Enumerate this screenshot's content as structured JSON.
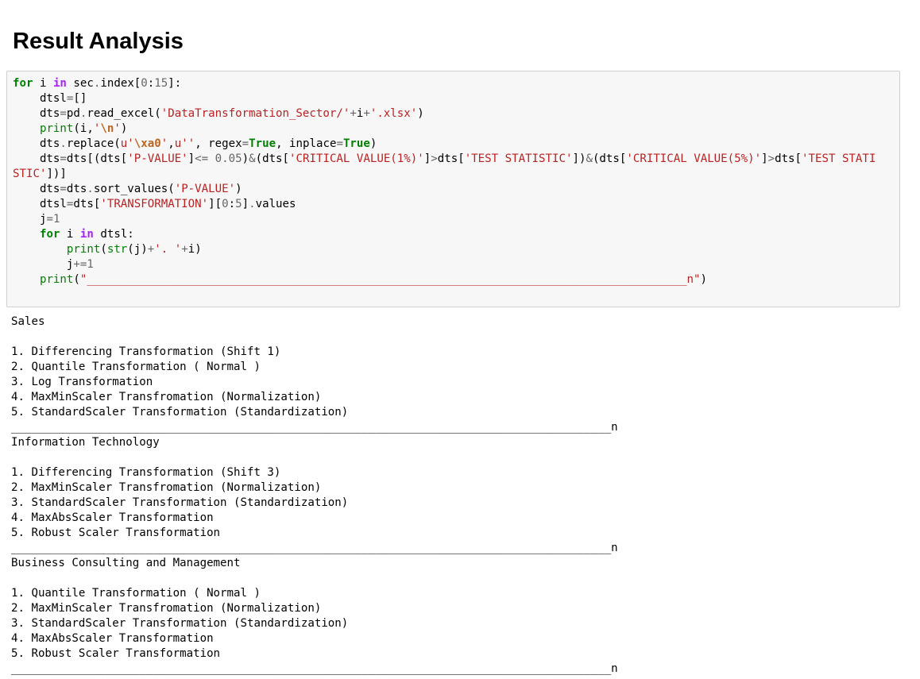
{
  "heading": "Result Analysis",
  "code": {
    "lines": [
      [
        [
          "kw",
          "for"
        ],
        [
          "",
          " i "
        ],
        [
          "kw2",
          "in"
        ],
        [
          "",
          " sec"
        ],
        [
          "op",
          "."
        ],
        [
          "",
          "index["
        ],
        [
          "num",
          "0"
        ],
        [
          "",
          ":"
        ],
        [
          "num",
          "15"
        ],
        [
          "",
          "]:"
        ]
      ],
      [
        [
          "",
          "    dtsl"
        ],
        [
          "op",
          "="
        ],
        [
          "",
          "[]"
        ]
      ],
      [
        [
          "",
          "    dts"
        ],
        [
          "op",
          "="
        ],
        [
          "",
          "pd"
        ],
        [
          "op",
          "."
        ],
        [
          "",
          "read_excel("
        ],
        [
          "str",
          "'DataTransformation_Sector/'"
        ],
        [
          "op",
          "+"
        ],
        [
          "",
          "i"
        ],
        [
          "op",
          "+"
        ],
        [
          "str",
          "'.xlsx'"
        ],
        [
          "",
          ")"
        ]
      ],
      [
        [
          "",
          "    "
        ],
        [
          "bi",
          "print"
        ],
        [
          "",
          "(i,"
        ],
        [
          "str",
          "'"
        ],
        [
          "esc",
          "\\n"
        ],
        [
          "str",
          "'"
        ],
        [
          "",
          ")"
        ]
      ],
      [
        [
          "",
          "    dts"
        ],
        [
          "op",
          "."
        ],
        [
          "",
          "replace("
        ],
        [
          "str",
          "u'"
        ],
        [
          "esc",
          "\\xa0"
        ],
        [
          "str",
          "'"
        ],
        [
          "",
          ","
        ],
        [
          "str",
          "u''"
        ],
        [
          "",
          ", regex"
        ],
        [
          "op",
          "="
        ],
        [
          "kw",
          "True"
        ],
        [
          "",
          ", inplace"
        ],
        [
          "op",
          "="
        ],
        [
          "kw",
          "True"
        ],
        [
          "",
          ")"
        ]
      ],
      [
        [
          "",
          "    dts"
        ],
        [
          "op",
          "="
        ],
        [
          "",
          "dts[(dts["
        ],
        [
          "str",
          "'P-VALUE'"
        ],
        [
          "",
          "]"
        ],
        [
          "op",
          "<="
        ],
        [
          "",
          " "
        ],
        [
          "num",
          "0.05"
        ],
        [
          "",
          ")"
        ],
        [
          "op",
          "&"
        ],
        [
          "",
          "(dts["
        ],
        [
          "str",
          "'CRITICAL VALUE(1%)'"
        ],
        [
          "",
          "]"
        ],
        [
          "op",
          ">"
        ],
        [
          "",
          "dts["
        ],
        [
          "str",
          "'TEST STATISTIC'"
        ],
        [
          "",
          "])"
        ],
        [
          "op",
          "&"
        ],
        [
          "",
          "(dts["
        ],
        [
          "str",
          "'CRITICAL VALUE(5%)'"
        ],
        [
          "",
          "]"
        ],
        [
          "op",
          ">"
        ],
        [
          "",
          "dts["
        ],
        [
          "str",
          "'TEST STATI"
        ]
      ],
      [
        [
          "str",
          "STIC'"
        ],
        [
          "",
          "])]"
        ]
      ],
      [
        [
          "",
          "    dts"
        ],
        [
          "op",
          "="
        ],
        [
          "",
          "dts"
        ],
        [
          "op",
          "."
        ],
        [
          "",
          "sort_values("
        ],
        [
          "str",
          "'P-VALUE'"
        ],
        [
          "",
          ")"
        ]
      ],
      [
        [
          "",
          "    dtsl"
        ],
        [
          "op",
          "="
        ],
        [
          "",
          "dts["
        ],
        [
          "str",
          "'TRANSFORMATION'"
        ],
        [
          "",
          "]["
        ],
        [
          "num",
          "0"
        ],
        [
          "",
          ":"
        ],
        [
          "num",
          "5"
        ],
        [
          "",
          "]"
        ],
        [
          "op",
          "."
        ],
        [
          "",
          "values"
        ]
      ],
      [
        [
          "",
          "    j"
        ],
        [
          "op",
          "="
        ],
        [
          "num",
          "1"
        ]
      ],
      [
        [
          "",
          "    "
        ],
        [
          "kw",
          "for"
        ],
        [
          "",
          " i "
        ],
        [
          "kw2",
          "in"
        ],
        [
          "",
          " dtsl:"
        ]
      ],
      [
        [
          "",
          "        "
        ],
        [
          "bi",
          "print"
        ],
        [
          "",
          "("
        ],
        [
          "bi",
          "str"
        ],
        [
          "",
          "(j)"
        ],
        [
          "op",
          "+"
        ],
        [
          "str",
          "'. '"
        ],
        [
          "op",
          "+"
        ],
        [
          "",
          "i)"
        ]
      ],
      [
        [
          "",
          "        j"
        ],
        [
          "op",
          "+="
        ],
        [
          "num",
          "1"
        ]
      ],
      [
        [
          "",
          "    "
        ],
        [
          "bi",
          "print"
        ],
        [
          "",
          "("
        ],
        [
          "str",
          "\"_________________________________________________________________________________________n\""
        ],
        [
          "",
          ")"
        ]
      ]
    ]
  },
  "output": {
    "sections": [
      {
        "sector": "Sales",
        "items": [
          "1. Differencing Transformation (Shift 1)",
          "2. Quantile Transformation ( Normal )",
          "3. Log Transformation",
          "4. MaxMinScaler Transfromation (Normalization)",
          "5. StandardScaler Transformation (Standardization)"
        ],
        "separator": "_________________________________________________________________________________________n"
      },
      {
        "sector": "Information Technology",
        "items": [
          "1. Differencing Transformation (Shift 3)",
          "2. MaxMinScaler Transfromation (Normalization)",
          "3. StandardScaler Transformation (Standardization)",
          "4. MaxAbsScaler Transformation",
          "5. Robust Scaler Transformation"
        ],
        "separator": "_________________________________________________________________________________________n"
      },
      {
        "sector": "Business Consulting and Management",
        "items": [
          "1. Quantile Transformation ( Normal )",
          "2. MaxMinScaler Transfromation (Normalization)",
          "3. StandardScaler Transformation (Standardization)",
          "4. MaxAbsScaler Transformation",
          "5. Robust Scaler Transformation"
        ],
        "separator": "_________________________________________________________________________________________n"
      }
    ]
  },
  "colors": {
    "keyword": "#008000",
    "keyword_in": "#aa22ff",
    "string": "#ba2121",
    "escape": "#bb6622",
    "number": "#666666",
    "cell_background": "#f7f7f7",
    "cell_border": "#cfcfcf"
  }
}
